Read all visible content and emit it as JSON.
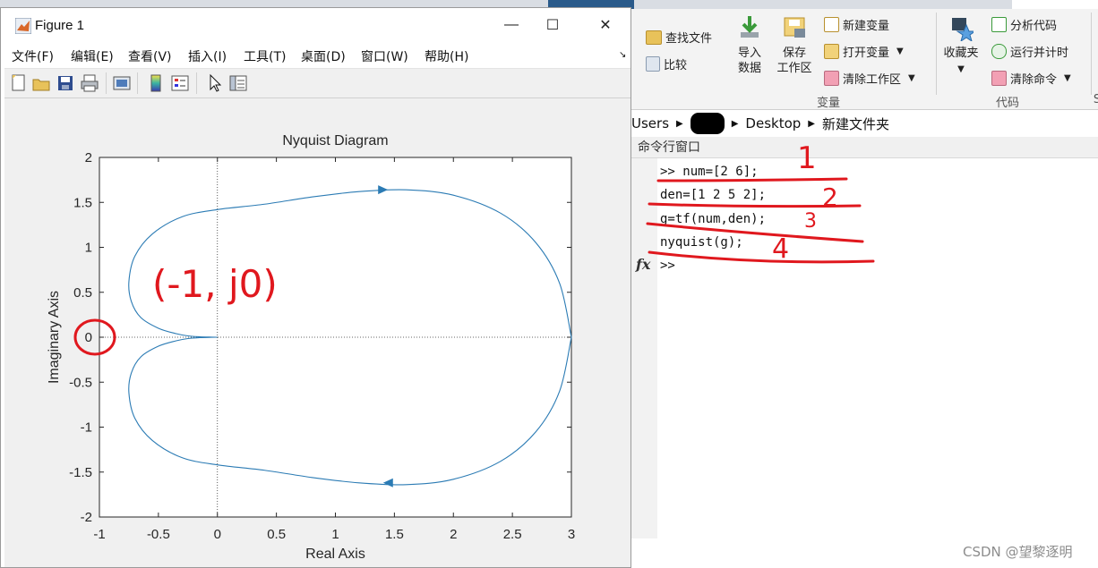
{
  "figure": {
    "title": "Figure 1",
    "menu": [
      "文件(F)",
      "编辑(E)",
      "查看(V)",
      "插入(I)",
      "工具(T)",
      "桌面(D)",
      "窗口(W)",
      "帮助(H)"
    ],
    "controls": {
      "minimize": "—",
      "maximize": "☐",
      "close": "✕"
    }
  },
  "toolstrip": {
    "find_files": "查找文件",
    "compare": "比较",
    "import_data": [
      "导入",
      "数据"
    ],
    "save_workspace": [
      "保存",
      "工作区"
    ],
    "new_variable": "新建变量",
    "open_variable": "打开变量",
    "clear_workspace": "清除工作区",
    "favorites": "收藏夹",
    "analyze_code": "分析代码",
    "run_and_time": "运行并计时",
    "clear_commands": "清除命令",
    "group_variable": "变量",
    "group_code": "代码",
    "cut_off_edge": "S"
  },
  "address": {
    "crumbs": [
      "Users",
      "Desktop",
      "新建文件夹"
    ]
  },
  "command_window": {
    "header": "命令行窗口",
    "lines": [
      ">> num=[2 6];",
      "den=[1 2 5 2];",
      "g=tf(num,den);",
      "nyquist(g);"
    ],
    "prompt": ">>",
    "fx": "fx"
  },
  "annotations": {
    "numbers": [
      "1",
      "2",
      "3",
      "4"
    ],
    "point_label": "(-1, j0)"
  },
  "watermark": "CSDN @望黎逐明",
  "colors": {
    "curve": "#2b7bb4",
    "annotation": "#e0181e"
  },
  "chart_data": {
    "type": "line",
    "title": "Nyquist Diagram",
    "xlabel": "Real Axis",
    "ylabel": "Imaginary Axis",
    "xlim": [
      -1,
      3
    ],
    "ylim": [
      -2,
      2
    ],
    "xticks": [
      "-1",
      "-0.5",
      "0",
      "0.5",
      "1",
      "1.5",
      "2",
      "2.5",
      "3"
    ],
    "yticks": [
      "2",
      "1.5",
      "1",
      "0.5",
      "0",
      "-0.5",
      "-1",
      "-1.5",
      "-2"
    ],
    "series": [
      {
        "x": [
          3.0,
          2.9,
          2.7,
          2.4,
          2.0,
          1.6,
          1.2,
          0.8,
          0.4,
          0.0,
          -0.3,
          -0.55,
          -0.7,
          -0.75,
          -0.73,
          -0.65,
          -0.5,
          -0.35,
          -0.25,
          -0.15,
          -0.05,
          0.0
        ],
        "y": [
          0.0,
          0.6,
          1.05,
          1.38,
          1.58,
          1.64,
          1.62,
          1.56,
          1.48,
          1.42,
          1.34,
          1.15,
          0.9,
          0.62,
          0.4,
          0.22,
          0.1,
          0.04,
          0.015,
          0.005,
          0.001,
          0.0
        ]
      },
      {
        "x": [
          3.0,
          2.9,
          2.7,
          2.4,
          2.0,
          1.6,
          1.2,
          0.8,
          0.4,
          0.0,
          -0.3,
          -0.55,
          -0.7,
          -0.75,
          -0.73,
          -0.65,
          -0.5,
          -0.35,
          -0.25,
          -0.15,
          -0.05,
          0.0
        ],
        "y": [
          0.0,
          -0.6,
          -1.05,
          -1.38,
          -1.58,
          -1.64,
          -1.62,
          -1.56,
          -1.48,
          -1.42,
          -1.34,
          -1.15,
          -0.9,
          -0.62,
          -0.4,
          -0.22,
          -0.1,
          -0.04,
          -0.015,
          -0.005,
          -0.001,
          0.0
        ]
      }
    ],
    "arrows": [
      {
        "x": 1.4,
        "y": 1.64,
        "direction": "right"
      },
      {
        "x": 1.45,
        "y": -1.62,
        "direction": "left"
      }
    ],
    "grid": false
  }
}
